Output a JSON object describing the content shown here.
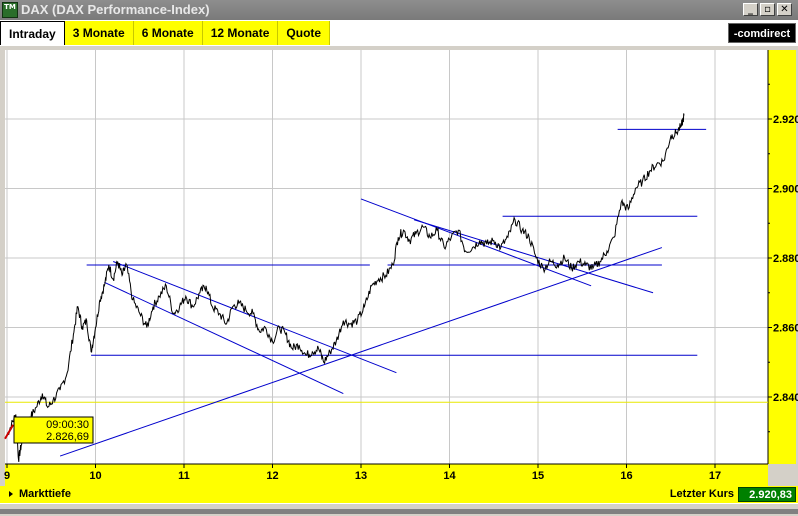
{
  "window": {
    "title": "DAX (DAX Performance-Index)",
    "icon_text": "TM",
    "buttons": [
      "_",
      "▫",
      "✕"
    ]
  },
  "tabs": [
    {
      "label": "Intraday",
      "active": true
    },
    {
      "label": "3 Monate",
      "active": false
    },
    {
      "label": "6 Monate",
      "active": false
    },
    {
      "label": "12 Monate",
      "active": false
    },
    {
      "label": "Quote",
      "active": false
    }
  ],
  "logo": "-comdirect",
  "tooltip": {
    "time": "09:00:30",
    "value": "2.826,69"
  },
  "bottom": {
    "markttiefe": "Markttiefe",
    "letzter_kurs_label": "Letzter Kurs",
    "letzter_kurs_value": "2.920,83"
  },
  "colors": {
    "accent": "#ffff00",
    "line": "#0000cc",
    "price": "#000000",
    "value_bg": "#008000"
  },
  "chart_data": {
    "type": "line",
    "x_ticks": [
      "9",
      "10",
      "11",
      "12",
      "13",
      "14",
      "15",
      "16",
      "17"
    ],
    "y_ticks": [
      "2.840",
      "2.860",
      "2.880",
      "2.900",
      "2.920"
    ],
    "xlim": [
      9,
      17
    ],
    "ylim": [
      2820,
      2936
    ],
    "grid": true,
    "series": [
      {
        "points": [
          [
            9.0,
            2829
          ],
          [
            9.05,
            2832
          ],
          [
            9.1,
            2835
          ],
          [
            9.13,
            2822
          ],
          [
            9.16,
            2826
          ],
          [
            9.2,
            2830
          ],
          [
            9.26,
            2834
          ],
          [
            9.33,
            2837
          ],
          [
            9.4,
            2841
          ],
          [
            9.46,
            2837
          ],
          [
            9.52,
            2839
          ],
          [
            9.6,
            2842
          ],
          [
            9.68,
            2847
          ],
          [
            9.75,
            2858
          ],
          [
            9.8,
            2866
          ],
          [
            9.85,
            2860
          ],
          [
            9.9,
            2862
          ],
          [
            9.95,
            2853
          ],
          [
            10.0,
            2860
          ],
          [
            10.05,
            2868
          ],
          [
            10.1,
            2872
          ],
          [
            10.15,
            2878
          ],
          [
            10.2,
            2874
          ],
          [
            10.25,
            2879
          ],
          [
            10.3,
            2875
          ],
          [
            10.35,
            2878
          ],
          [
            10.42,
            2868
          ],
          [
            10.5,
            2864
          ],
          [
            10.58,
            2860
          ],
          [
            10.65,
            2866
          ],
          [
            10.72,
            2869
          ],
          [
            10.8,
            2872
          ],
          [
            10.88,
            2864
          ],
          [
            10.95,
            2866
          ],
          [
            11.02,
            2869
          ],
          [
            11.1,
            2866
          ],
          [
            11.18,
            2870
          ],
          [
            11.25,
            2872
          ],
          [
            11.32,
            2866
          ],
          [
            11.4,
            2864
          ],
          [
            11.48,
            2861
          ],
          [
            11.55,
            2866
          ],
          [
            11.62,
            2867
          ],
          [
            11.7,
            2865
          ],
          [
            11.78,
            2864
          ],
          [
            11.85,
            2859
          ],
          [
            11.92,
            2860
          ],
          [
            12.0,
            2856
          ],
          [
            12.08,
            2860
          ],
          [
            12.15,
            2858
          ],
          [
            12.22,
            2854
          ],
          [
            12.3,
            2855
          ],
          [
            12.38,
            2852
          ],
          [
            12.45,
            2853
          ],
          [
            12.52,
            2854
          ],
          [
            12.58,
            2850
          ],
          [
            12.65,
            2853
          ],
          [
            12.72,
            2856
          ],
          [
            12.8,
            2862
          ],
          [
            12.88,
            2861
          ],
          [
            12.96,
            2862
          ],
          [
            13.04,
            2866
          ],
          [
            13.12,
            2872
          ],
          [
            13.2,
            2874
          ],
          [
            13.28,
            2875
          ],
          [
            13.36,
            2878
          ],
          [
            13.42,
            2886
          ],
          [
            13.48,
            2888
          ],
          [
            13.55,
            2885
          ],
          [
            13.62,
            2887
          ],
          [
            13.7,
            2889
          ],
          [
            13.78,
            2886
          ],
          [
            13.86,
            2888
          ],
          [
            13.94,
            2883
          ],
          [
            14.02,
            2886
          ],
          [
            14.1,
            2888
          ],
          [
            14.18,
            2882
          ],
          [
            14.26,
            2883
          ],
          [
            14.34,
            2885
          ],
          [
            14.42,
            2884
          ],
          [
            14.5,
            2885
          ],
          [
            14.58,
            2883
          ],
          [
            14.66,
            2886
          ],
          [
            14.74,
            2891
          ],
          [
            14.82,
            2888
          ],
          [
            14.9,
            2886
          ],
          [
            14.98,
            2880
          ],
          [
            15.06,
            2877
          ],
          [
            15.14,
            2879
          ],
          [
            15.22,
            2878
          ],
          [
            15.3,
            2880
          ],
          [
            15.38,
            2877
          ],
          [
            15.46,
            2879
          ],
          [
            15.54,
            2878
          ],
          [
            15.62,
            2877
          ],
          [
            15.7,
            2879
          ],
          [
            15.78,
            2882
          ],
          [
            15.86,
            2886
          ],
          [
            15.94,
            2896
          ],
          [
            16.02,
            2894
          ],
          [
            16.1,
            2900
          ],
          [
            16.18,
            2902
          ],
          [
            16.26,
            2905
          ],
          [
            16.34,
            2907
          ],
          [
            16.42,
            2908
          ],
          [
            16.5,
            2915
          ],
          [
            16.56,
            2916
          ],
          [
            16.62,
            2918
          ],
          [
            16.65,
            2921
          ]
        ]
      }
    ],
    "trendlines": [
      {
        "x1": 9.95,
        "y1": 2852,
        "x2": 16.8,
        "y2": 2852
      },
      {
        "x1": 9.9,
        "y1": 2878,
        "x2": 13.1,
        "y2": 2878
      },
      {
        "x1": 13.3,
        "y1": 2878,
        "x2": 16.4,
        "y2": 2878
      },
      {
        "x1": 14.6,
        "y1": 2892,
        "x2": 16.8,
        "y2": 2892
      },
      {
        "x1": 15.9,
        "y1": 2917,
        "x2": 16.9,
        "y2": 2917
      },
      {
        "x1": 9.6,
        "y1": 2823,
        "x2": 16.4,
        "y2": 2883
      },
      {
        "x1": 10.2,
        "y1": 2879,
        "x2": 13.4,
        "y2": 2847
      },
      {
        "x1": 10.1,
        "y1": 2873,
        "x2": 12.8,
        "y2": 2841
      },
      {
        "x1": 13.0,
        "y1": 2897,
        "x2": 15.6,
        "y2": 2872
      },
      {
        "x1": 13.6,
        "y1": 2891,
        "x2": 16.3,
        "y2": 2870
      }
    ]
  }
}
